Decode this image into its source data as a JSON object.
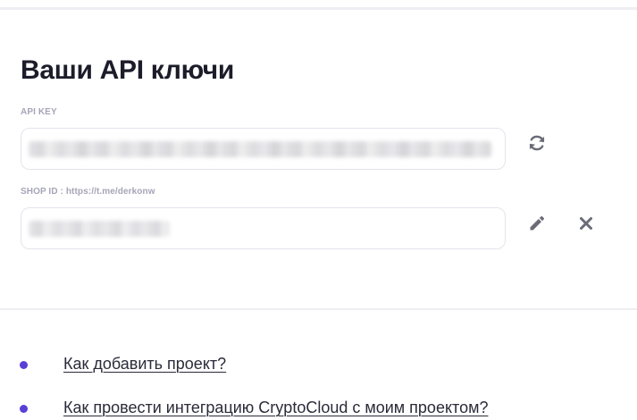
{
  "keys_card": {
    "title": "Ваши API ключи",
    "api_key": {
      "label": "API KEY",
      "value_hidden": true
    },
    "shop_id": {
      "label": "SHOP ID : https://t.me/derkonw",
      "value_hidden": true
    },
    "actions": {
      "refresh_icon": "refresh-icon",
      "edit_icon": "pencil-icon",
      "delete_icon": "close-icon"
    }
  },
  "help": {
    "links": [
      {
        "label": "Как добавить проект?"
      },
      {
        "label": "Как провести интеграцию CryptoCloud с моим проектом?"
      }
    ]
  },
  "colors": {
    "title": "#1c1c2a",
    "label": "#a5a5b8",
    "field_border": "#e4e4ec",
    "icon": "#6b6b78",
    "bullet": "#5a3fd6",
    "link": "#2b2b3a"
  }
}
